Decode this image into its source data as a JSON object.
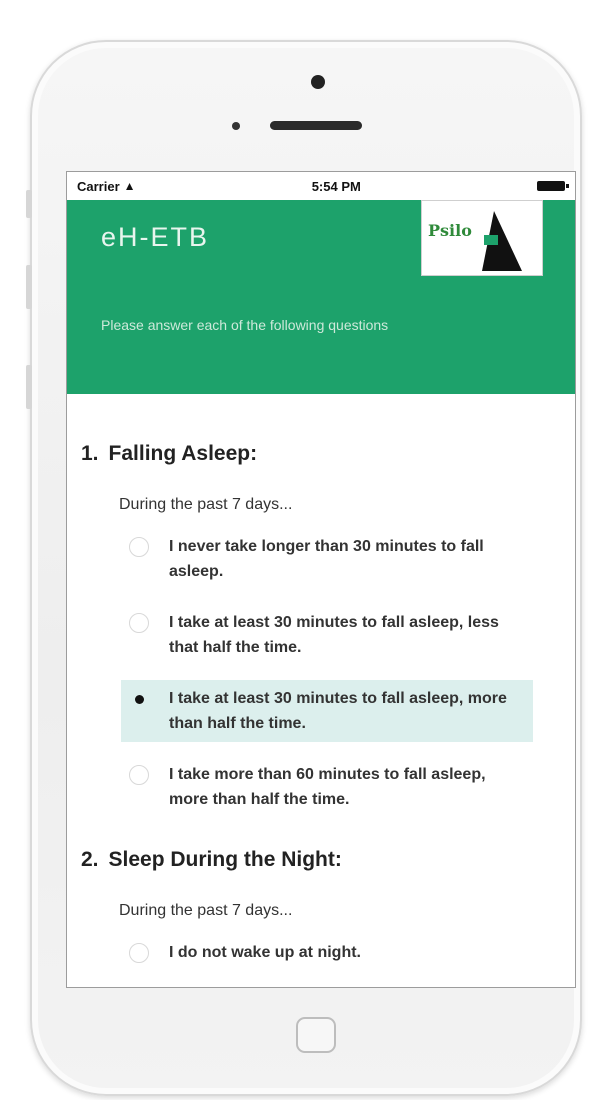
{
  "status_bar": {
    "carrier": "Carrier",
    "wifi_icon": "wifi-icon",
    "time": "5:54 PM",
    "battery_icon": "battery-icon"
  },
  "header": {
    "title": "eH-ETB",
    "logo_text": "Psilo",
    "instruction": "Please answer each of the following questions",
    "color": "#1da26b"
  },
  "questions": [
    {
      "number": "1.",
      "title": "Falling Asleep:",
      "period": "During the past 7 days...",
      "options": [
        {
          "label": "I never take longer than 30 minutes to fall asleep.",
          "selected": false
        },
        {
          "label": "I take at least 30 minutes to fall asleep, less that half the time.",
          "selected": false
        },
        {
          "label": "I take at least 30 minutes to fall asleep, more than half the time.",
          "selected": true
        },
        {
          "label": "I take more than 60 minutes to fall asleep, more than half the time.",
          "selected": false
        }
      ]
    },
    {
      "number": "2.",
      "title": "Sleep During the Night:",
      "period": "During the past 7 days...",
      "options": [
        {
          "label": "I do not wake up at night.",
          "selected": false
        }
      ]
    }
  ],
  "selected_highlight_color": "#dcefed"
}
